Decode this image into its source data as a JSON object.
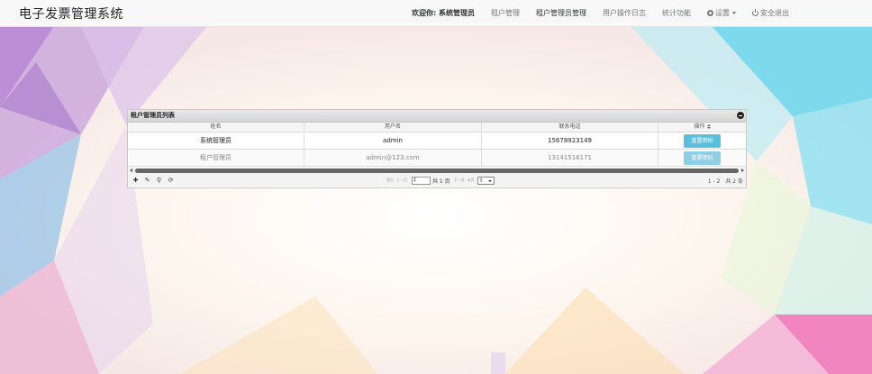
{
  "app": {
    "title": "电子发票管理系统"
  },
  "nav": {
    "welcome": "欢迎你: 系统管理员",
    "items": [
      {
        "label": "租户管理"
      },
      {
        "label": "租户管理员管理"
      },
      {
        "label": "用户操作日志"
      },
      {
        "label": "统计功能"
      }
    ],
    "settings": {
      "label": "设置",
      "icon": "gear-icon"
    },
    "logout": {
      "label": "安全退出",
      "icon": "power-icon"
    }
  },
  "grid": {
    "caption": "租户管理员列表",
    "columns": [
      "姓名",
      "用户名",
      "联系电话",
      "操作"
    ],
    "rows": [
      {
        "name": "系统管理员",
        "username": "admin",
        "phone": "15678923149",
        "action": "重置密码"
      },
      {
        "name": "租户管理员",
        "username": "admin@123.com",
        "phone": "13141516171",
        "action": "重置密码"
      }
    ],
    "pager": {
      "first": "首页",
      "prev": "上一页",
      "page": "1",
      "total_pages": "共 1 页",
      "next": "下一页",
      "last": "末页",
      "page_size": "5",
      "info": "1 - 2　共 2 条"
    },
    "tools": [
      "add-icon",
      "edit-icon",
      "search-icon",
      "refresh-icon"
    ]
  },
  "colors": {
    "accent": "#5bc0de",
    "navbar": "#f8f8f8"
  }
}
